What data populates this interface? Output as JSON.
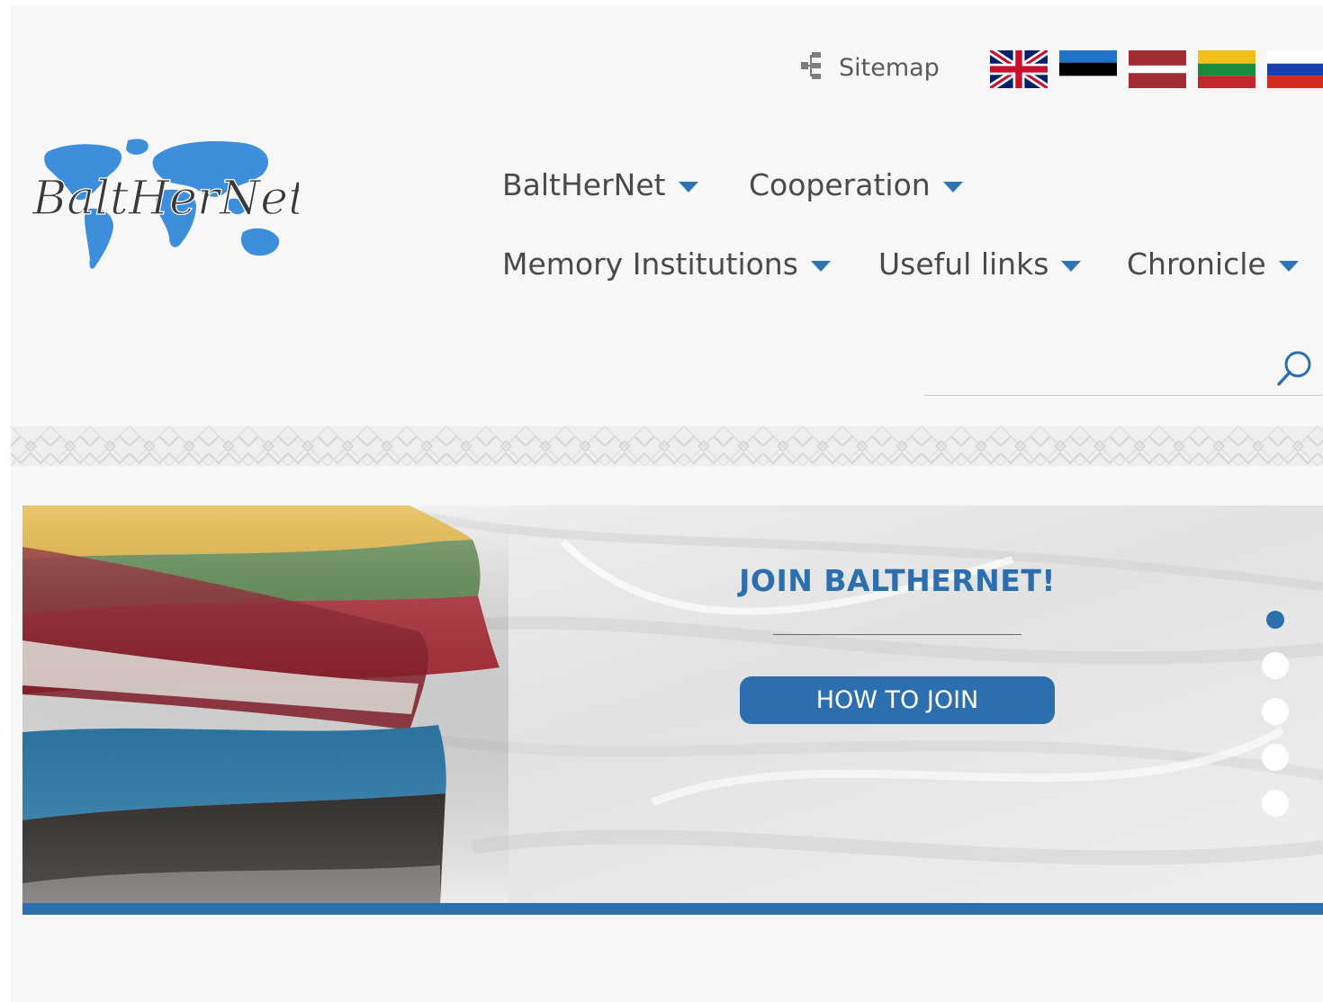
{
  "topbar": {
    "sitemap_label": "Sitemap",
    "languages": [
      {
        "code": "en",
        "icon": "uk-flag-icon"
      },
      {
        "code": "et",
        "icon": "estonia-flag-icon"
      },
      {
        "code": "lv",
        "icon": "latvia-flag-icon"
      },
      {
        "code": "lt",
        "icon": "lithuania-flag-icon"
      },
      {
        "code": "ru",
        "icon": "russia-flag-icon"
      }
    ]
  },
  "logo": {
    "text": "BaltHerNet",
    "icon": "world-map-icon"
  },
  "nav": {
    "items": [
      {
        "label": "BaltHerNet"
      },
      {
        "label": "Cooperation"
      },
      {
        "label": "Memory Institutions"
      },
      {
        "label": "Useful links"
      },
      {
        "label": "Chronicle"
      }
    ]
  },
  "search": {
    "placeholder": "",
    "icon": "search-icon"
  },
  "hero": {
    "title": "JOIN BALTHERNET!",
    "button_label": "HOW TO JOIN",
    "slide_count": 5,
    "active_slide": 1
  },
  "colors": {
    "accent": "#2c6fae",
    "background": "#f7f7f7",
    "text": "#4a4a4a"
  }
}
